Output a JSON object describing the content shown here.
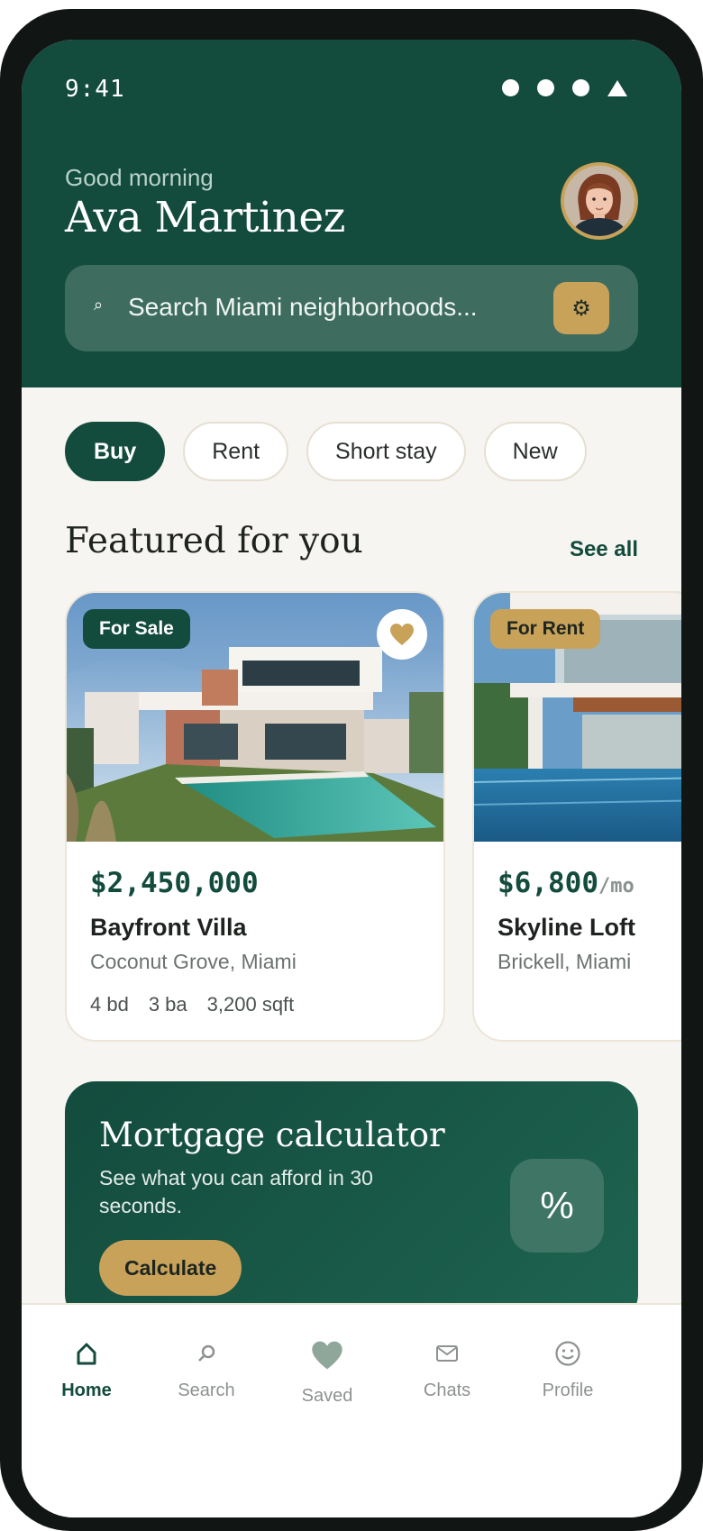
{
  "status": {
    "time": "9:41"
  },
  "header": {
    "greeting": "Good morning",
    "name": "Ava Martinez",
    "search_placeholder": "Search Miami neighborhoods..."
  },
  "chips": [
    "Buy",
    "Rent",
    "Short stay",
    "New"
  ],
  "featured": {
    "title": "Featured for you",
    "see_all": "See all",
    "listings": [
      {
        "badge": "For Sale",
        "price": "$2,450,000",
        "price_unit": "",
        "name": "Bayfront Villa",
        "location": "Coconut Grove, Miami",
        "beds": "4 bd",
        "baths": "3 ba",
        "area": "3,200 sqft"
      },
      {
        "badge": "For Rent",
        "price": "$6,800",
        "price_unit": "/mo",
        "name": "Skyline Loft",
        "location": "Brickell, Miami"
      }
    ]
  },
  "mortgage": {
    "title": "Mortgage calculator",
    "subtitle": "See what you can afford in 30 seconds.",
    "button": "Calculate",
    "icon_text": "%"
  },
  "nav": [
    "Home",
    "Search",
    "Saved",
    "Chats",
    "Profile"
  ],
  "colors": {
    "primary": "#134b3d",
    "accent": "#c9a25a",
    "background": "#f7f5f1"
  }
}
